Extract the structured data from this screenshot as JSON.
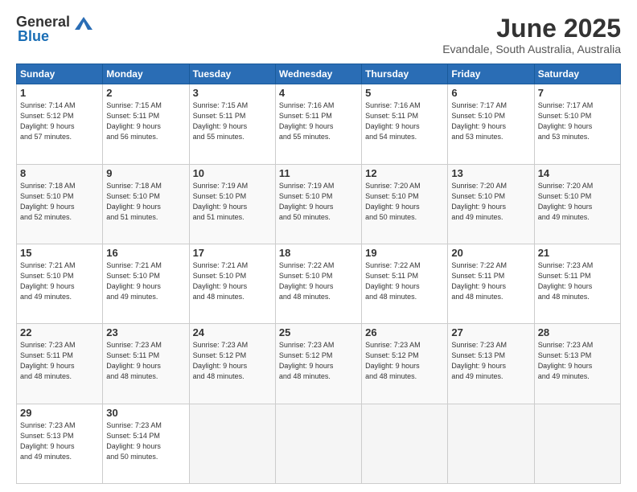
{
  "header": {
    "logo_general": "General",
    "logo_blue": "Blue",
    "title": "June 2025",
    "subtitle": "Evandale, South Australia, Australia"
  },
  "columns": [
    "Sunday",
    "Monday",
    "Tuesday",
    "Wednesday",
    "Thursday",
    "Friday",
    "Saturday"
  ],
  "weeks": [
    [
      {
        "day": "1",
        "info": "Sunrise: 7:14 AM\nSunset: 5:12 PM\nDaylight: 9 hours\nand 57 minutes."
      },
      {
        "day": "2",
        "info": "Sunrise: 7:15 AM\nSunset: 5:11 PM\nDaylight: 9 hours\nand 56 minutes."
      },
      {
        "day": "3",
        "info": "Sunrise: 7:15 AM\nSunset: 5:11 PM\nDaylight: 9 hours\nand 55 minutes."
      },
      {
        "day": "4",
        "info": "Sunrise: 7:16 AM\nSunset: 5:11 PM\nDaylight: 9 hours\nand 55 minutes."
      },
      {
        "day": "5",
        "info": "Sunrise: 7:16 AM\nSunset: 5:11 PM\nDaylight: 9 hours\nand 54 minutes."
      },
      {
        "day": "6",
        "info": "Sunrise: 7:17 AM\nSunset: 5:10 PM\nDaylight: 9 hours\nand 53 minutes."
      },
      {
        "day": "7",
        "info": "Sunrise: 7:17 AM\nSunset: 5:10 PM\nDaylight: 9 hours\nand 53 minutes."
      }
    ],
    [
      {
        "day": "8",
        "info": "Sunrise: 7:18 AM\nSunset: 5:10 PM\nDaylight: 9 hours\nand 52 minutes."
      },
      {
        "day": "9",
        "info": "Sunrise: 7:18 AM\nSunset: 5:10 PM\nDaylight: 9 hours\nand 51 minutes."
      },
      {
        "day": "10",
        "info": "Sunrise: 7:19 AM\nSunset: 5:10 PM\nDaylight: 9 hours\nand 51 minutes."
      },
      {
        "day": "11",
        "info": "Sunrise: 7:19 AM\nSunset: 5:10 PM\nDaylight: 9 hours\nand 50 minutes."
      },
      {
        "day": "12",
        "info": "Sunrise: 7:20 AM\nSunset: 5:10 PM\nDaylight: 9 hours\nand 50 minutes."
      },
      {
        "day": "13",
        "info": "Sunrise: 7:20 AM\nSunset: 5:10 PM\nDaylight: 9 hours\nand 49 minutes."
      },
      {
        "day": "14",
        "info": "Sunrise: 7:20 AM\nSunset: 5:10 PM\nDaylight: 9 hours\nand 49 minutes."
      }
    ],
    [
      {
        "day": "15",
        "info": "Sunrise: 7:21 AM\nSunset: 5:10 PM\nDaylight: 9 hours\nand 49 minutes."
      },
      {
        "day": "16",
        "info": "Sunrise: 7:21 AM\nSunset: 5:10 PM\nDaylight: 9 hours\nand 49 minutes."
      },
      {
        "day": "17",
        "info": "Sunrise: 7:21 AM\nSunset: 5:10 PM\nDaylight: 9 hours\nand 48 minutes."
      },
      {
        "day": "18",
        "info": "Sunrise: 7:22 AM\nSunset: 5:10 PM\nDaylight: 9 hours\nand 48 minutes."
      },
      {
        "day": "19",
        "info": "Sunrise: 7:22 AM\nSunset: 5:11 PM\nDaylight: 9 hours\nand 48 minutes."
      },
      {
        "day": "20",
        "info": "Sunrise: 7:22 AM\nSunset: 5:11 PM\nDaylight: 9 hours\nand 48 minutes."
      },
      {
        "day": "21",
        "info": "Sunrise: 7:23 AM\nSunset: 5:11 PM\nDaylight: 9 hours\nand 48 minutes."
      }
    ],
    [
      {
        "day": "22",
        "info": "Sunrise: 7:23 AM\nSunset: 5:11 PM\nDaylight: 9 hours\nand 48 minutes."
      },
      {
        "day": "23",
        "info": "Sunrise: 7:23 AM\nSunset: 5:11 PM\nDaylight: 9 hours\nand 48 minutes."
      },
      {
        "day": "24",
        "info": "Sunrise: 7:23 AM\nSunset: 5:12 PM\nDaylight: 9 hours\nand 48 minutes."
      },
      {
        "day": "25",
        "info": "Sunrise: 7:23 AM\nSunset: 5:12 PM\nDaylight: 9 hours\nand 48 minutes."
      },
      {
        "day": "26",
        "info": "Sunrise: 7:23 AM\nSunset: 5:12 PM\nDaylight: 9 hours\nand 48 minutes."
      },
      {
        "day": "27",
        "info": "Sunrise: 7:23 AM\nSunset: 5:13 PM\nDaylight: 9 hours\nand 49 minutes."
      },
      {
        "day": "28",
        "info": "Sunrise: 7:23 AM\nSunset: 5:13 PM\nDaylight: 9 hours\nand 49 minutes."
      }
    ],
    [
      {
        "day": "29",
        "info": "Sunrise: 7:23 AM\nSunset: 5:13 PM\nDaylight: 9 hours\nand 49 minutes."
      },
      {
        "day": "30",
        "info": "Sunrise: 7:23 AM\nSunset: 5:14 PM\nDaylight: 9 hours\nand 50 minutes."
      },
      {
        "day": "",
        "info": ""
      },
      {
        "day": "",
        "info": ""
      },
      {
        "day": "",
        "info": ""
      },
      {
        "day": "",
        "info": ""
      },
      {
        "day": "",
        "info": ""
      }
    ]
  ]
}
